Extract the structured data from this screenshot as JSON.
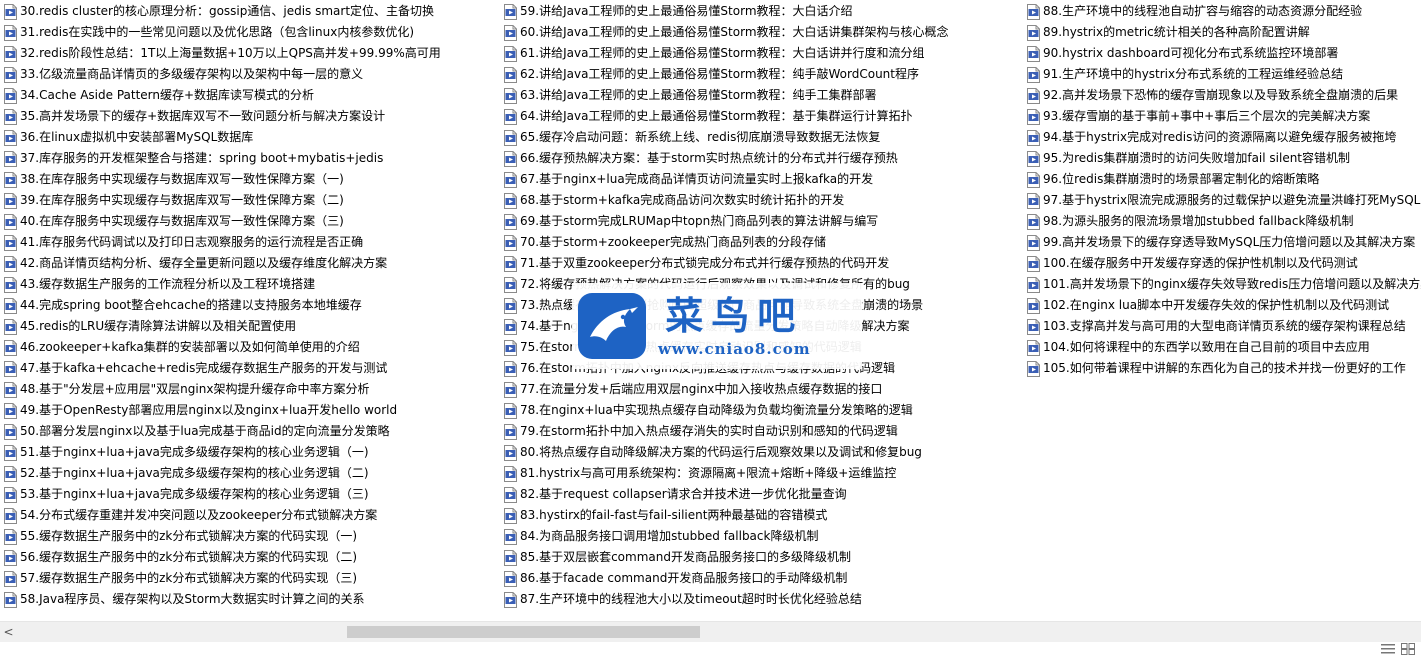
{
  "watermark": {
    "title": "菜鸟吧",
    "url": "www.cniao8.com"
  },
  "icon": {
    "file_type": "video-file-icon",
    "badge": "AVI",
    "color": "#3b5fb5"
  },
  "scrollbar": {
    "left_arrow": "<"
  },
  "columns": [
    [
      "30.redis cluster的核心原理分析：gossip通信、jedis smart定位、主备切换",
      "31.redis在实践中的一些常见问题以及优化思路（包含linux内核参数优化)",
      "32.redis阶段性总结：1T以上海量数据+10万以上QPS高并发+99.99%高可用",
      "33.亿级流量商品详情页的多级缓存架构以及架构中每一层的意义",
      "34.Cache Aside Pattern缓存+数据库读写模式的分析",
      "35.高并发场景下的缓存+数据库双写不一致问题分析与解决方案设计",
      "36.在linux虚拟机中安装部署MySQL数据库",
      "37.库存服务的开发框架整合与搭建：spring boot+mybatis+jedis",
      "38.在库存服务中实现缓存与数据库双写一致性保障方案（一)",
      "39.在库存服务中实现缓存与数据库双写一致性保障方案（二)",
      "40.在库存服务中实现缓存与数据库双写一致性保障方案（三)",
      "41.库存服务代码调试以及打印日志观察服务的运行流程是否正确",
      "42.商品详情页结构分析、缓存全量更新问题以及缓存维度化解决方案",
      "43.缓存数据生产服务的工作流程分析以及工程环境搭建",
      "44.完成spring boot整合ehcache的搭建以支持服务本地堆缓存",
      "45.redis的LRU缓存清除算法讲解以及相关配置使用",
      "46.zookeeper+kafka集群的安装部署以及如何简单使用的介绍",
      "47.基于kafka+ehcache+redis完成缓存数据生产服务的开发与测试",
      "48.基于\"分发层+应用层\"双层nginx架构提升缓存命中率方案分析",
      "49.基于OpenResty部署应用层nginx以及nginx+lua开发hello world",
      "50.部署分发层nginx以及基于lua完成基于商品id的定向流量分发策略",
      "51.基于nginx+lua+java完成多级缓存架构的核心业务逻辑（一)",
      "52.基于nginx+lua+java完成多级缓存架构的核心业务逻辑（二)",
      "53.基于nginx+lua+java完成多级缓存架构的核心业务逻辑（三)",
      "54.分布式缓存重建并发冲突问题以及zookeeper分布式锁解决方案",
      "55.缓存数据生产服务中的zk分布式锁解决方案的代码实现（一)",
      "56.缓存数据生产服务中的zk分布式锁解决方案的代码实现（二)",
      "57.缓存数据生产服务中的zk分布式锁解决方案的代码实现（三)",
      "58.Java程序员、缓存架构以及Storm大数据实时计算之间的关系"
    ],
    [
      "59.讲给Java工程师的史上最通俗易懂Storm教程：大白话介绍",
      "60.讲给Java工程师的史上最通俗易懂Storm教程：大白话讲集群架构与核心概念",
      "61.讲给Java工程师的史上最通俗易懂Storm教程：大白话讲并行度和流分组",
      "62.讲给Java工程师的史上最通俗易懂Storm教程：纯手敲WordCount程序",
      "63.讲给Java工程师的史上最通俗易懂Storm教程：纯手工集群部署",
      "64.讲给Java工程师的史上最通俗易懂Storm教程：基于集群运行计算拓扑",
      "65.缓存冷启动问题：新系统上线、redis彻底崩溃导致数据无法恢复",
      "66.缓存预热解决方案：基于storm实时热点统计的分布式并行缓存预热",
      "67.基于nginx+lua完成商品详情页访问流量实时上报kafka的开发",
      "68.基于storm+kafka完成商品访问次数实时统计拓扑的开发",
      "69.基于storm完成LRUMap中topn热门商品列表的算法讲解与编写",
      "70.基于storm+zookeeper完成热门商品列表的分段存储",
      "71.基于双重zookeeper分布式锁完成分布式并行缓存预热的代码开发",
      "72.将缓存预热解决方案的代码运行后观察效果以及调试和修复所有的bug",
      "73.热点缓存问题：促销抢购时的超级热门商品可能导致系统全盘崩溃的场景",
      "74.基于nginx+lua+storm的热点缓存的流量分发策略自动降级解决方案",
      "75.在storm拓扑中加入热点缓存实时自动识别和感知的代码逻辑",
      "76.在storm拓扑中加入nginx反向推送缓存热点与缓存数据的代码逻辑",
      "77.在流量分发+后端应用双层nginx中加入接收热点缓存数据的接口",
      "78.在nginx+lua中实现热点缓存自动降级为负载均衡流量分发策略的逻辑",
      "79.在storm拓扑中加入热点缓存消失的实时自动识别和感知的代码逻辑",
      "80.将热点缓存自动降级解决方案的代码运行后观察效果以及调试和修复bug",
      "81.hystrix与高可用系统架构：资源隔离+限流+熔断+降级+运维监控",
      "82.基于request collapser请求合并技术进一步优化批量查询",
      "83.hystirx的fail-fast与fail-silient两种最基础的容错模式",
      "84.为商品服务接口调用增加stubbed fallback降级机制",
      "85.基于双层嵌套command开发商品服务接口的多级降级机制",
      "86.基于facade command开发商品服务接口的手动降级机制",
      "87.生产环境中的线程池大小以及timeout超时时长优化经验总结"
    ],
    [
      "88.生产环境中的线程池自动扩容与缩容的动态资源分配经验",
      "89.hystrix的metric统计相关的各种高阶配置讲解",
      "90.hystrix dashboard可视化分布式系统监控环境部署",
      "91.生产环境中的hystrix分布式系统的工程运维经验总结",
      "92.高并发场景下恐怖的缓存雪崩现象以及导致系统全盘崩溃的后果",
      "93.缓存雪崩的基于事前+事中+事后三个层次的完美解决方案",
      "94.基于hystrix完成对redis访问的资源隔离以避免缓存服务被拖垮",
      "95.为redis集群崩溃时的访问失败增加fail silent容错机制",
      "96.位redis集群崩溃时的场景部署定制化的熔断策略",
      "97.基于hystrix限流完成源服务的过载保护以避免流量洪峰打死MySQL",
      "98.为源头服务的限流场景增加stubbed fallback降级机制",
      "99.高并发场景下的缓存穿透导致MySQL压力倍增问题以及其解决方案",
      "100.在缓存服务中开发缓存穿透的保护性机制以及代码测试",
      "101.高并发场景下的nginx缓存失效导致redis压力倍增问题以及解决方案",
      "102.在nginx lua脚本中开发缓存失效的保护性机制以及代码测试",
      "103.支撑高并发与高可用的大型电商详情页系统的缓存架构课程总结",
      "104.如何将课程中的东西学以致用在自己目前的项目中去应用",
      "105.如何带着课程中讲解的东西化为自己的技术并找一份更好的工作"
    ]
  ]
}
